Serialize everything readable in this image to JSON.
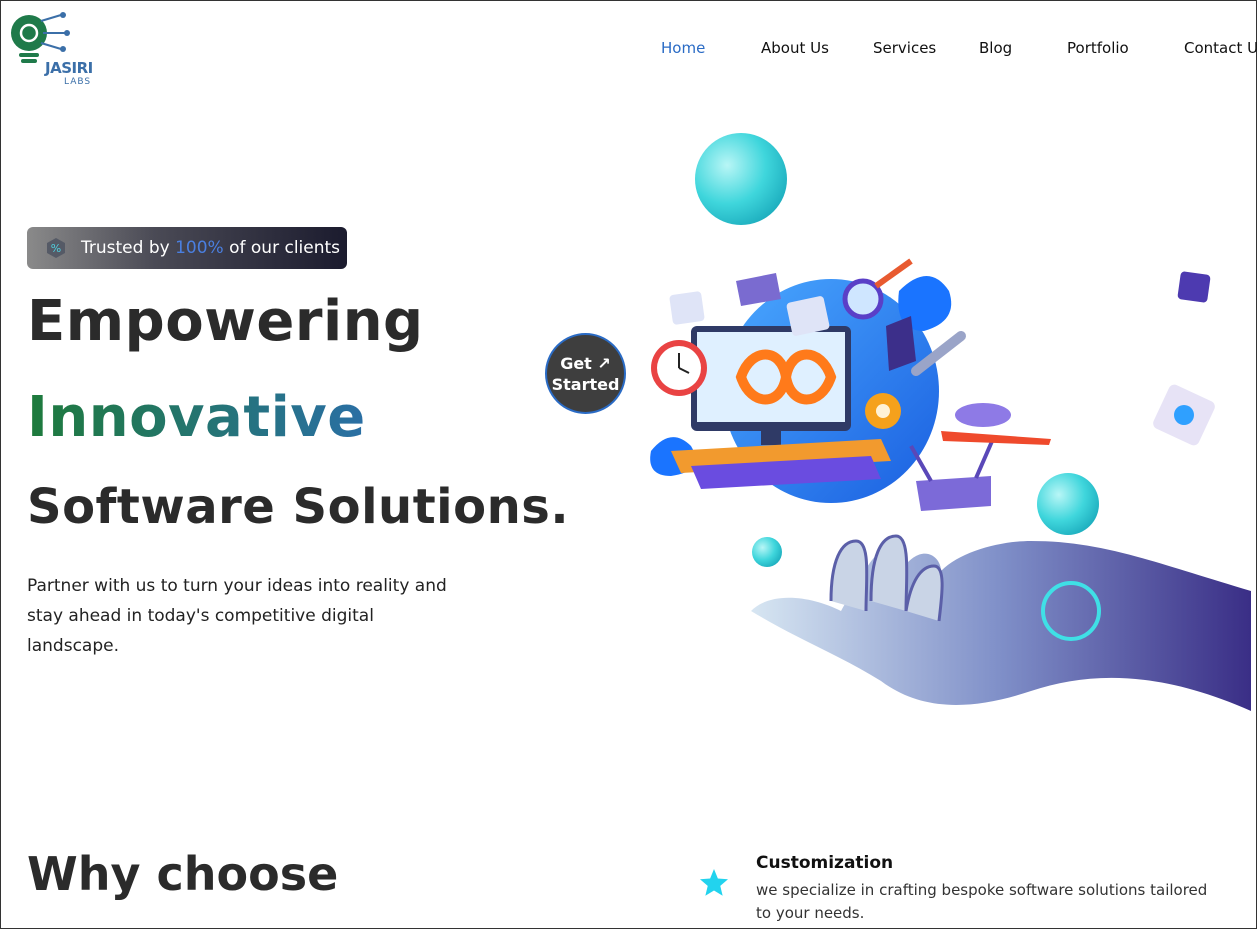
{
  "brand": {
    "logo_text": "JASIRI",
    "logo_sub": "LABS"
  },
  "nav": {
    "items": [
      {
        "label": "Home",
        "active": true
      },
      {
        "label": "About Us",
        "active": false
      },
      {
        "label": "Services",
        "active": false
      },
      {
        "label": "Blog",
        "active": false
      },
      {
        "label": "Portfolio",
        "active": false
      },
      {
        "label": "Contact Us",
        "active": false
      }
    ]
  },
  "hero": {
    "badge": {
      "prefix": "Trusted by",
      "highlight": "100%",
      "suffix": "of our clients",
      "icon": "percent-icon"
    },
    "heading_line1": "Empowering",
    "heading_line2": "Innovative",
    "heading_line3": "Software Solutions.",
    "description": "Partner with us to turn your ideas into reality and stay ahead in today's competitive digital landscape.",
    "cta_line1": "Get",
    "cta_arrow": "↗",
    "cta_line2": "Started"
  },
  "why": {
    "heading": "Why choose"
  },
  "features": [
    {
      "title": "Customization",
      "description": "we specialize in crafting bespoke software solutions tailored to your needs.",
      "icon": "star-icon"
    }
  ],
  "colors": {
    "accent_blue": "#2a6bc5",
    "green": "#1e7a3b",
    "star_cyan": "#22d3ee"
  }
}
